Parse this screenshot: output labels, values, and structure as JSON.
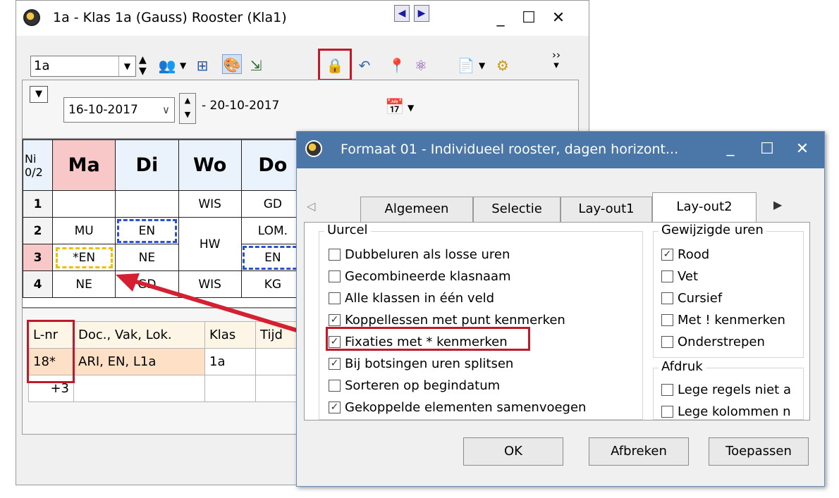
{
  "main_window": {
    "title": "1a - Klas 1a (Gauss)  Rooster  (Kla1)",
    "class_select": "1a",
    "date_from": "16-10-2017",
    "date_to": "- 20-10-2017"
  },
  "timetable": {
    "corner": "Ni\n0/2",
    "days": [
      "Ma",
      "Di",
      "Wo",
      "Do"
    ],
    "rows": [
      {
        "num": "1",
        "cells": [
          "",
          "",
          "WIS",
          "GD"
        ]
      },
      {
        "num": "2",
        "cells": [
          "MU",
          "EN",
          "HW",
          "LOM."
        ]
      },
      {
        "num": "3",
        "cells": [
          "*EN",
          "NE",
          "",
          "EN"
        ]
      },
      {
        "num": "4",
        "cells": [
          "NE",
          "GD",
          "WIS",
          "KG"
        ]
      }
    ]
  },
  "lessons": {
    "headers": [
      "L-nr",
      "Doc., Vak, Lok.",
      "Klas",
      "Tijd"
    ],
    "rows": [
      {
        "lnr": "18*",
        "doc": "ARI, EN, L1a",
        "klas": "1a"
      },
      {
        "lnr": "+3",
        "doc": "",
        "klas": ""
      }
    ]
  },
  "dialog": {
    "title": "Formaat 01 - Individueel rooster, dagen horizont...",
    "tabs": [
      "Algemeen",
      "Selectie",
      "Lay-out1",
      "Lay-out2"
    ],
    "uurcel": {
      "title": "Uurcel",
      "options": [
        {
          "label": "Dubbeluren als losse uren",
          "checked": false
        },
        {
          "label": "Gecombineerde klasnaam",
          "checked": false
        },
        {
          "label": "Alle klassen in één veld",
          "checked": false
        },
        {
          "label": "Koppellessen met punt kenmerken",
          "checked": true
        },
        {
          "label": "Fixaties met * kenmerken",
          "checked": true
        },
        {
          "label": "Bij botsingen uren splitsen",
          "checked": true
        },
        {
          "label": "Sorteren op begindatum",
          "checked": false
        },
        {
          "label": "Gekoppelde elementen samenvoegen",
          "checked": true
        }
      ]
    },
    "gewijzigd": {
      "title": "Gewijzigde uren",
      "options": [
        {
          "label": "Rood",
          "checked": true
        },
        {
          "label": "Vet",
          "checked": false
        },
        {
          "label": "Cursief",
          "checked": false
        },
        {
          "label": "Met ! kenmerken",
          "checked": false
        },
        {
          "label": "Onderstrepen",
          "checked": false
        }
      ]
    },
    "afdruk": {
      "title": "Afdruk",
      "options": [
        {
          "label": "Lege regels niet a",
          "checked": false
        },
        {
          "label": "Lege kolommen n",
          "checked": false
        }
      ]
    },
    "buttons": {
      "ok": "OK",
      "cancel": "Afbreken",
      "apply": "Toepassen"
    }
  },
  "colors": {
    "highlight": "#c01a2a",
    "dialog_title_bg": "#4a77a8",
    "monday_bg": "#f8c8c8"
  }
}
